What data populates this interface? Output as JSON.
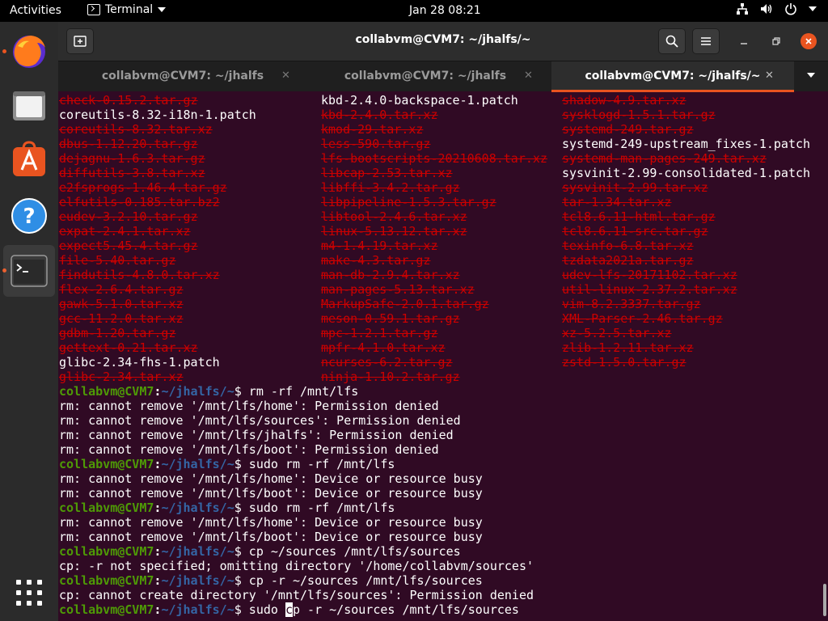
{
  "topbar": {
    "activities": "Activities",
    "app_menu": "Terminal",
    "clock": "Jan 28  08:21"
  },
  "window": {
    "title": "collabvm@CVM7: ~/jhalfs/~"
  },
  "tabs": [
    {
      "label": "collabvm@CVM7: ~/jhalfs",
      "active": false
    },
    {
      "label": "collabvm@CVM7: ~/jhalfs",
      "active": false
    },
    {
      "label": "collabvm@CVM7: ~/jhalfs/~",
      "active": true
    }
  ],
  "listing": {
    "col1": [
      {
        "text": "check-0.15.2.tar.gz",
        "archive": true
      },
      {
        "text": "coreutils-8.32-i18n-1.patch",
        "archive": false
      },
      {
        "text": "coreutils-8.32.tar.xz",
        "archive": true
      },
      {
        "text": "dbus-1.12.20.tar.gz",
        "archive": true
      },
      {
        "text": "dejagnu-1.6.3.tar.gz",
        "archive": true
      },
      {
        "text": "diffutils-3.8.tar.xz",
        "archive": true
      },
      {
        "text": "e2fsprogs-1.46.4.tar.gz",
        "archive": true
      },
      {
        "text": "elfutils-0.185.tar.bz2",
        "archive": true
      },
      {
        "text": "eudev-3.2.10.tar.gz",
        "archive": true
      },
      {
        "text": "expat-2.4.1.tar.xz",
        "archive": true
      },
      {
        "text": "expect5.45.4.tar.gz",
        "archive": true
      },
      {
        "text": "file-5.40.tar.gz",
        "archive": true
      },
      {
        "text": "findutils-4.8.0.tar.xz",
        "archive": true
      },
      {
        "text": "flex-2.6.4.tar.gz",
        "archive": true
      },
      {
        "text": "gawk-5.1.0.tar.xz",
        "archive": true
      },
      {
        "text": "gcc-11.2.0.tar.xz",
        "archive": true
      },
      {
        "text": "gdbm-1.20.tar.gz",
        "archive": true
      },
      {
        "text": "gettext-0.21.tar.xz",
        "archive": true
      },
      {
        "text": "glibc-2.34-fhs-1.patch",
        "archive": false
      },
      {
        "text": "glibc-2.34.tar.xz",
        "archive": true
      }
    ],
    "col2": [
      {
        "text": "kbd-2.4.0-backspace-1.patch",
        "archive": false
      },
      {
        "text": "kbd-2.4.0.tar.xz",
        "archive": true
      },
      {
        "text": "kmod-29.tar.xz",
        "archive": true
      },
      {
        "text": "less-590.tar.gz",
        "archive": true
      },
      {
        "text": "lfs-bootscripts-20210608.tar.xz",
        "archive": true
      },
      {
        "text": "libcap-2.53.tar.xz",
        "archive": true
      },
      {
        "text": "libffi-3.4.2.tar.gz",
        "archive": true
      },
      {
        "text": "libpipeline-1.5.3.tar.gz",
        "archive": true
      },
      {
        "text": "libtool-2.4.6.tar.xz",
        "archive": true
      },
      {
        "text": "linux-5.13.12.tar.xz",
        "archive": true
      },
      {
        "text": "m4-1.4.19.tar.xz",
        "archive": true
      },
      {
        "text": "make-4.3.tar.gz",
        "archive": true
      },
      {
        "text": "man-db-2.9.4.tar.xz",
        "archive": true
      },
      {
        "text": "man-pages-5.13.tar.xz",
        "archive": true
      },
      {
        "text": "MarkupSafe-2.0.1.tar.gz",
        "archive": true
      },
      {
        "text": "meson-0.59.1.tar.gz",
        "archive": true
      },
      {
        "text": "mpc-1.2.1.tar.gz",
        "archive": true
      },
      {
        "text": "mpfr-4.1.0.tar.xz",
        "archive": true
      },
      {
        "text": "ncurses-6.2.tar.gz",
        "archive": true
      },
      {
        "text": "ninja-1.10.2.tar.gz",
        "archive": true
      }
    ],
    "col3": [
      {
        "text": "shadow-4.9.tar.xz",
        "archive": true
      },
      {
        "text": "sysklogd-1.5.1.tar.gz",
        "archive": true
      },
      {
        "text": "systemd-249.tar.gz",
        "archive": true
      },
      {
        "text": "systemd-249-upstream_fixes-1.patch",
        "archive": false
      },
      {
        "text": "systemd-man-pages-249.tar.xz",
        "archive": true
      },
      {
        "text": "sysvinit-2.99-consolidated-1.patch",
        "archive": false
      },
      {
        "text": "sysvinit-2.99.tar.xz",
        "archive": true
      },
      {
        "text": "tar-1.34.tar.xz",
        "archive": true
      },
      {
        "text": "tcl8.6.11-html.tar.gz",
        "archive": true
      },
      {
        "text": "tcl8.6.11-src.tar.gz",
        "archive": true
      },
      {
        "text": "texinfo-6.8.tar.xz",
        "archive": true
      },
      {
        "text": "tzdata2021a.tar.gz",
        "archive": true
      },
      {
        "text": "udev-lfs-20171102.tar.xz",
        "archive": true
      },
      {
        "text": "util-linux-2.37.2.tar.xz",
        "archive": true
      },
      {
        "text": "vim-8.2.3337.tar.gz",
        "archive": true
      },
      {
        "text": "XML-Parser-2.46.tar.gz",
        "archive": true
      },
      {
        "text": "xz-5.2.5.tar.xz",
        "archive": true
      },
      {
        "text": "zlib-1.2.11.tar.xz",
        "archive": true
      },
      {
        "text": "zstd-1.5.0.tar.gz",
        "archive": true
      }
    ]
  },
  "session": [
    {
      "type": "prompt",
      "user": "collabvm@CVM7",
      "path": "~/jhalfs/~",
      "cmd": " rm -rf /mnt/lfs"
    },
    {
      "type": "out",
      "text": "rm: cannot remove '/mnt/lfs/home': Permission denied"
    },
    {
      "type": "out",
      "text": "rm: cannot remove '/mnt/lfs/sources': Permission denied"
    },
    {
      "type": "out",
      "text": "rm: cannot remove '/mnt/lfs/jhalfs': Permission denied"
    },
    {
      "type": "out",
      "text": "rm: cannot remove '/mnt/lfs/boot': Permission denied"
    },
    {
      "type": "prompt",
      "user": "collabvm@CVM7",
      "path": "~/jhalfs/~",
      "cmd": " sudo rm -rf /mnt/lfs"
    },
    {
      "type": "out",
      "text": "rm: cannot remove '/mnt/lfs/home': Device or resource busy"
    },
    {
      "type": "out",
      "text": "rm: cannot remove '/mnt/lfs/boot': Device or resource busy"
    },
    {
      "type": "prompt",
      "user": "collabvm@CVM7",
      "path": "~/jhalfs/~",
      "cmd": " sudo rm -rf /mnt/lfs"
    },
    {
      "type": "out",
      "text": "rm: cannot remove '/mnt/lfs/home': Device or resource busy"
    },
    {
      "type": "out",
      "text": "rm: cannot remove '/mnt/lfs/boot': Device or resource busy"
    },
    {
      "type": "prompt",
      "user": "collabvm@CVM7",
      "path": "~/jhalfs/~",
      "cmd": " cp ~/sources /mnt/lfs/sources"
    },
    {
      "type": "out",
      "text": "cp: -r not specified; omitting directory '/home/collabvm/sources'"
    },
    {
      "type": "prompt",
      "user": "collabvm@CVM7",
      "path": "~/jhalfs/~",
      "cmd": " cp -r ~/sources /mnt/lfs/sources"
    },
    {
      "type": "out",
      "text": "cp: cannot create directory '/mnt/lfs/sources': Permission denied"
    },
    {
      "type": "current",
      "user": "collabvm@CVM7",
      "path": "~/jhalfs/~",
      "before": " sudo ",
      "cursor": "c",
      "after": "p -r ~/sources /mnt/lfs/sources"
    }
  ],
  "icons": {
    "dock": [
      "firefox-icon",
      "files-icon",
      "software-icon",
      "help-icon",
      "terminal-icon",
      "app-grid-icon"
    ],
    "tray": [
      "network-icon",
      "volume-icon",
      "power-icon",
      "chevron-down-icon"
    ]
  },
  "colors": {
    "terminal_bg": "#300a24",
    "archive_red": "#cc0000",
    "prompt_green": "#4e9a06",
    "prompt_blue": "#3465a4",
    "accent": "#e95420"
  }
}
